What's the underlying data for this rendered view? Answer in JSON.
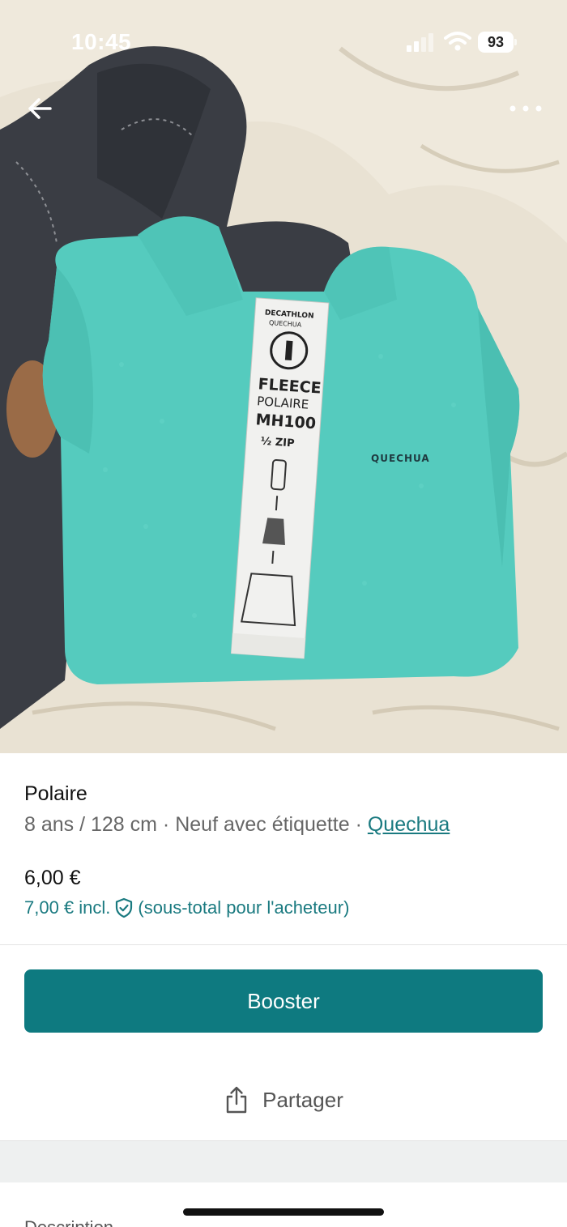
{
  "status_bar": {
    "time": "10:45",
    "battery": "93"
  },
  "product_photo": {
    "fleece_color": "#55cbbe",
    "tag_lines": [
      "DECATHLON",
      "QUECHUA",
      "FLEECE",
      "POLAIRE",
      "MH100",
      "½ ZIP"
    ],
    "embroidered_logo": "QUECHUA"
  },
  "product": {
    "title": "Polaire",
    "size": "8 ans / 128 cm",
    "separator": " · ",
    "condition": "Neuf avec étiquette",
    "brand": "Quechua",
    "price": "6,00 €",
    "price_incl": "7,00 € incl.",
    "price_incl_note": "(sous-total pour l'acheteur)"
  },
  "actions": {
    "boost_label": "Booster",
    "share_label": "Partager"
  },
  "description": {
    "heading": "Description"
  },
  "colors": {
    "accent": "#0e7a80",
    "link": "#1a7a80",
    "muted_text": "#666666",
    "section_gap": "#eef0f0"
  },
  "icons": [
    "back-arrow-icon",
    "more-options-icon",
    "cellular-signal-icon",
    "wifi-icon",
    "battery-icon",
    "shield-check-icon",
    "share-icon"
  ]
}
